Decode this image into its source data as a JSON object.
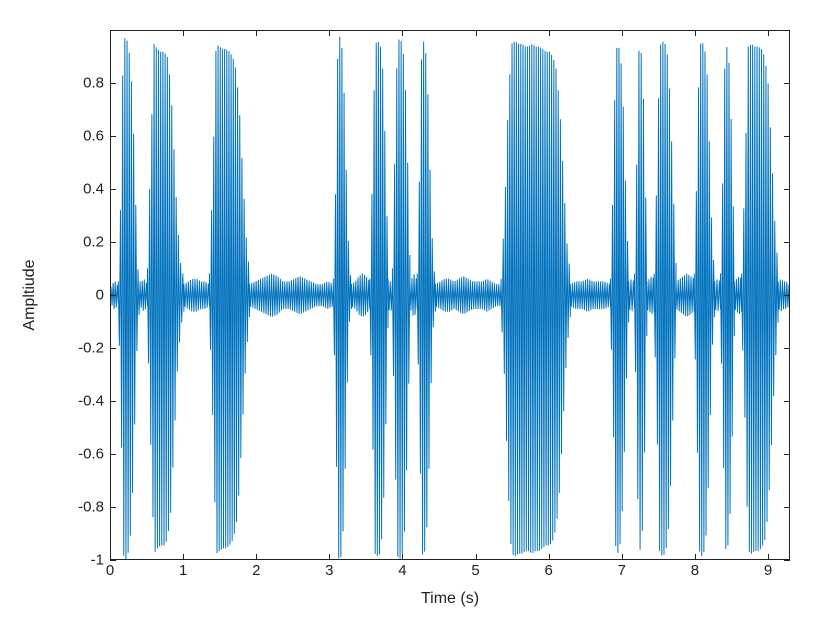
{
  "chart_data": {
    "type": "line",
    "title": "",
    "xlabel": "Time (s)",
    "ylabel": "Ampltiude",
    "xlim": [
      0,
      9.3
    ],
    "ylim": [
      -1,
      1
    ],
    "xticks": [
      0,
      1,
      2,
      3,
      4,
      5,
      6,
      7,
      8,
      9
    ],
    "yticks": [
      -1,
      -0.8,
      -0.6,
      -0.4,
      -0.2,
      0,
      0.2,
      0.4,
      0.6,
      0.8
    ],
    "line_color": "#0072BD",
    "segments": [
      {
        "t_start": 0.0,
        "t_end": 0.1,
        "envelope": [
          0.03,
          0.04,
          0.05,
          0.05,
          0.04,
          0.03
        ]
      },
      {
        "t_start": 0.1,
        "t_end": 0.4,
        "envelope": [
          0.05,
          0.35,
          0.95,
          0.98,
          0.95,
          0.88,
          0.7,
          0.4,
          0.1,
          0.05
        ]
      },
      {
        "t_start": 0.4,
        "t_end": 0.5,
        "envelope": [
          0.04,
          0.05,
          0.06,
          0.05,
          0.04
        ]
      },
      {
        "t_start": 0.5,
        "t_end": 1.0,
        "envelope": [
          0.1,
          0.55,
          0.95,
          0.93,
          0.92,
          0.92,
          0.9,
          0.8,
          0.55,
          0.28,
          0.12,
          0.06
        ]
      },
      {
        "t_start": 1.0,
        "t_end": 1.35,
        "envelope": [
          0.04,
          0.05,
          0.06,
          0.06,
          0.05,
          0.05,
          0.04
        ]
      },
      {
        "t_start": 1.35,
        "t_end": 1.9,
        "envelope": [
          0.08,
          0.45,
          0.95,
          0.94,
          0.93,
          0.93,
          0.92,
          0.9,
          0.85,
          0.7,
          0.45,
          0.22,
          0.08
        ]
      },
      {
        "t_start": 1.9,
        "t_end": 3.05,
        "envelope": [
          0.04,
          0.05,
          0.06,
          0.07,
          0.08,
          0.07,
          0.05,
          0.05,
          0.06,
          0.07,
          0.06,
          0.05,
          0.04,
          0.04,
          0.05,
          0.04
        ]
      },
      {
        "t_start": 3.05,
        "t_end": 3.3,
        "envelope": [
          0.06,
          0.4,
          0.96,
          0.98,
          0.92,
          0.7,
          0.35,
          0.1,
          0.05
        ]
      },
      {
        "t_start": 3.3,
        "t_end": 3.55,
        "envelope": [
          0.04,
          0.05,
          0.07,
          0.08,
          0.07,
          0.05
        ]
      },
      {
        "t_start": 3.55,
        "t_end": 3.8,
        "envelope": [
          0.06,
          0.45,
          0.95,
          0.96,
          0.95,
          0.85,
          0.55,
          0.12
        ]
      },
      {
        "t_start": 3.8,
        "t_end": 3.86,
        "envelope": [
          0.06,
          0.05,
          0.06
        ]
      },
      {
        "t_start": 3.86,
        "t_end": 4.1,
        "envelope": [
          0.1,
          0.55,
          0.96,
          0.97,
          0.95,
          0.85,
          0.55,
          0.15
        ]
      },
      {
        "t_start": 4.1,
        "t_end": 4.2,
        "envelope": [
          0.05,
          0.06,
          0.08,
          0.07,
          0.05
        ]
      },
      {
        "t_start": 4.2,
        "t_end": 4.45,
        "envelope": [
          0.08,
          0.45,
          0.95,
          0.96,
          0.9,
          0.7,
          0.35,
          0.12,
          0.06
        ]
      },
      {
        "t_start": 4.45,
        "t_end": 5.35,
        "envelope": [
          0.04,
          0.05,
          0.06,
          0.06,
          0.05,
          0.06,
          0.07,
          0.06,
          0.05,
          0.05,
          0.05,
          0.06,
          0.05,
          0.04,
          0.04
        ]
      },
      {
        "t_start": 5.35,
        "t_end": 6.3,
        "envelope": [
          0.06,
          0.3,
          0.7,
          0.95,
          0.96,
          0.95,
          0.95,
          0.94,
          0.94,
          0.95,
          0.94,
          0.94,
          0.93,
          0.92,
          0.92,
          0.9,
          0.85,
          0.7,
          0.45,
          0.2,
          0.08
        ]
      },
      {
        "t_start": 6.3,
        "t_end": 6.85,
        "envelope": [
          0.04,
          0.05,
          0.05,
          0.06,
          0.05,
          0.05,
          0.05,
          0.04
        ]
      },
      {
        "t_start": 6.85,
        "t_end": 7.1,
        "envelope": [
          0.06,
          0.4,
          0.92,
          0.95,
          0.9,
          0.7,
          0.35,
          0.1
        ]
      },
      {
        "t_start": 7.1,
        "t_end": 7.18,
        "envelope": [
          0.05,
          0.06,
          0.05
        ]
      },
      {
        "t_start": 7.18,
        "t_end": 7.35,
        "envelope": [
          0.08,
          0.45,
          0.92,
          0.94,
          0.85,
          0.55,
          0.15
        ]
      },
      {
        "t_start": 7.35,
        "t_end": 7.45,
        "envelope": [
          0.05,
          0.06,
          0.07,
          0.06
        ]
      },
      {
        "t_start": 7.45,
        "t_end": 7.75,
        "envelope": [
          0.08,
          0.45,
          0.94,
          0.96,
          0.95,
          0.9,
          0.7,
          0.4,
          0.12
        ]
      },
      {
        "t_start": 7.75,
        "t_end": 8.0,
        "envelope": [
          0.05,
          0.06,
          0.07,
          0.08,
          0.07,
          0.06
        ]
      },
      {
        "t_start": 8.0,
        "t_end": 8.28,
        "envelope": [
          0.08,
          0.45,
          0.94,
          0.96,
          0.94,
          0.85,
          0.55,
          0.2,
          0.08
        ]
      },
      {
        "t_start": 8.28,
        "t_end": 8.36,
        "envelope": [
          0.05,
          0.06,
          0.05
        ]
      },
      {
        "t_start": 8.36,
        "t_end": 8.55,
        "envelope": [
          0.08,
          0.45,
          0.93,
          0.94,
          0.85,
          0.55,
          0.15
        ]
      },
      {
        "t_start": 8.55,
        "t_end": 8.65,
        "envelope": [
          0.05,
          0.06,
          0.07,
          0.06
        ]
      },
      {
        "t_start": 8.65,
        "t_end": 9.15,
        "envelope": [
          0.08,
          0.45,
          0.94,
          0.95,
          0.94,
          0.94,
          0.93,
          0.9,
          0.8,
          0.55,
          0.28,
          0.1
        ]
      },
      {
        "t_start": 9.15,
        "t_end": 9.3,
        "envelope": [
          0.05,
          0.06,
          0.05,
          0.05,
          0.04
        ]
      }
    ]
  }
}
